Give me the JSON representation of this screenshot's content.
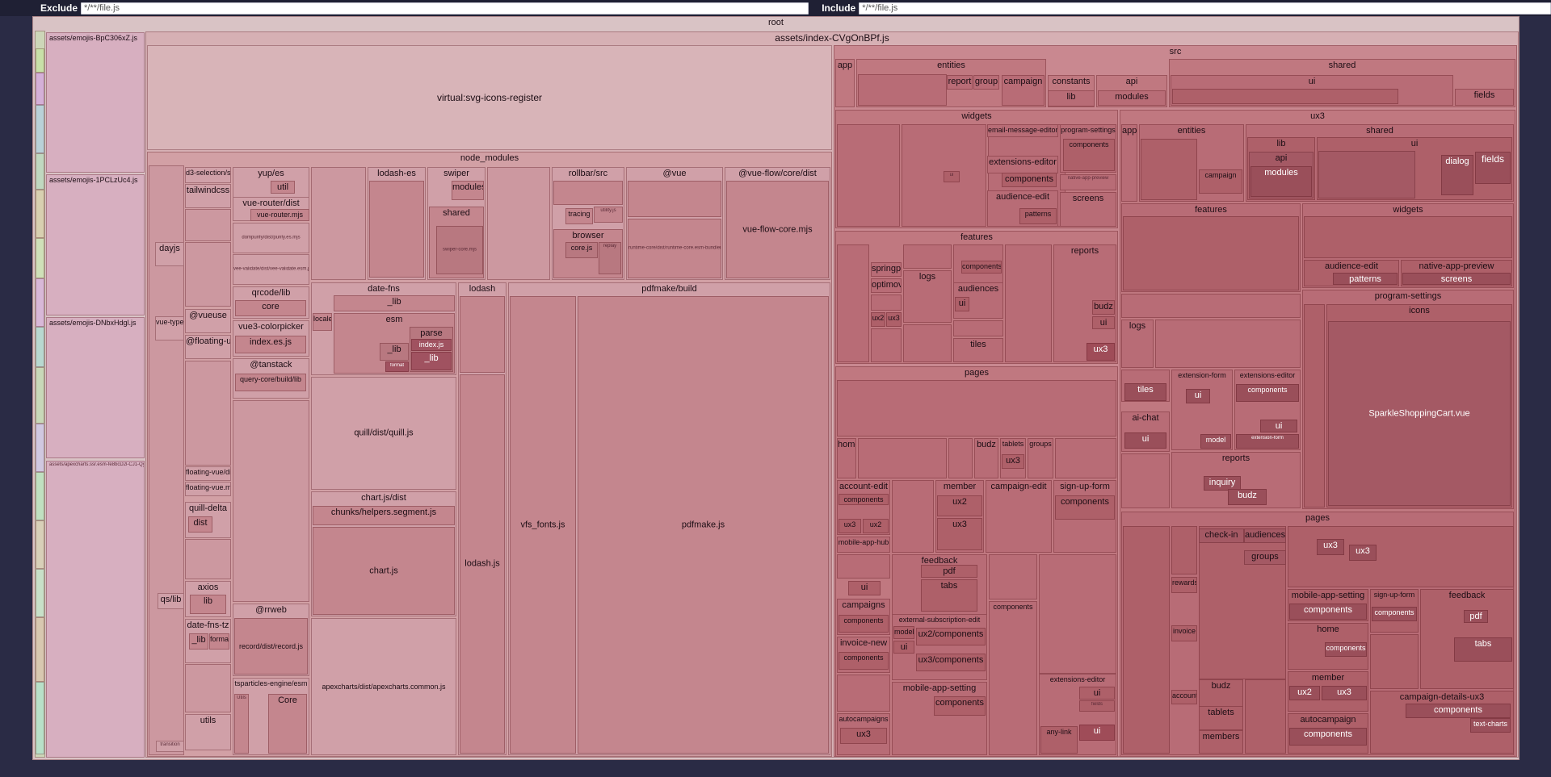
{
  "filters": {
    "exclude_label": "Exclude",
    "exclude_value": "*/**/file.js",
    "include_label": "Include",
    "include_value": "*/**/file.js"
  },
  "colors": {
    "background": "#2a2b45",
    "root": "#d9c3c5",
    "emoji": "#d7afc0",
    "index": "#d6b0b4",
    "node_modules": "#d2a0a5",
    "src": "#c98890",
    "dense": "#b7626d"
  },
  "treemap": {
    "root": "root",
    "emoji_chunks": [
      "assets/emojis-BpC306xZ.js",
      "assets/emojis-1PCLzUc4.js",
      "assets/emojis-DNbxHdgl.js",
      "assets/apexcharts.ssr.esm-fe8bcD2l-CJ1-Qyal.js"
    ],
    "index": {
      "title": "assets/index-CVgOnBPf.js",
      "svg_icons": "virtual:svg-icons-register",
      "node_modules": {
        "title": "node_modules",
        "packages": {
          "d3": "d3-selection/src",
          "tailwind": "tailwindcss",
          "dayjs": "dayjs",
          "vueuse": "@vueuse",
          "floating_ui": "@floating-ui",
          "vue_types": "vue-types",
          "floating_vue": "floating-vue/dist",
          "floating_vue_mjs": "floating-vue.mjs",
          "quill_delta": "quill-delta",
          "quill_delta_dist": "dist",
          "axios": "axios",
          "axios_lib": "lib",
          "qs": "qs/lib",
          "date_fns_tz": "date-fns-tz",
          "date_fns_tz_lib": "_lib",
          "date_fns_tz_format": "format",
          "utils": "utils",
          "transition": "transition",
          "yup": "yup/es",
          "yup_util": "util",
          "vue_router": "vue-router/dist",
          "vue_router_mjs": "vue-router.mjs",
          "dompurify": "dompurify/dist/purify.es.mjs",
          "vee_validate": "vee-validate/dist/vee-validate.esm.js",
          "qrcode": "qrcode/lib",
          "qrcode_core": "core",
          "colorpicker": "vue3-colorpicker",
          "colorpicker_index": "index.es.js",
          "tanstack": "@tanstack",
          "query_core": "query-core/build/lib",
          "rrweb": "@rrweb",
          "rrweb_record": "record/dist/record.js",
          "tsparticles": "tsparticles-engine/esm",
          "tsparticles_core": "Core",
          "tsparticles_utils": "Utils",
          "lodash_es": "lodash-es",
          "swiper": "swiper",
          "swiper_modules": "modules",
          "swiper_shared": "shared",
          "swiper_core": "swiper-core.mjs",
          "date_fns": "date-fns",
          "date_fns_lib": "_lib",
          "esm": "esm",
          "locale": "locale",
          "parse": "parse",
          "parse_index": "index.js",
          "parse_lib": "_lib",
          "esm_lib": "_lib",
          "esm_format": "format",
          "quill": "quill/dist/quill.js",
          "chartjs": "chart.js/dist",
          "chart_helpers": "chunks/helpers.segment.js",
          "chart_js": "chart.js",
          "apexcharts": "apexcharts/dist/apexcharts.common.js",
          "lodash": "lodash",
          "lodash_js": "lodash.js",
          "rollbar": "rollbar/src",
          "rollbar_utility": "utility.js",
          "rollbar_tracing": "tracing",
          "rollbar_browser": "browser",
          "rollbar_core": "core.js",
          "rollbar_replay": "replay",
          "vue": "@vue",
          "runtime_core": "runtime-core/dist/runtime-core.esm-bundler.js",
          "vue_flow": "@vue-flow/core/dist",
          "vue_flow_mjs": "vue-flow-core.mjs",
          "pdfmake": "pdfmake/build",
          "vfs_fonts": "vfs_fonts.js",
          "pdfmake_js": "pdfmake.js"
        }
      },
      "src": {
        "title": "src",
        "app": "app",
        "entities": "entities",
        "entities_items": [
          "report",
          "group",
          "campaign"
        ],
        "constants": "constants",
        "lib": "lib",
        "api": "api",
        "modules": "modules",
        "shared": "shared",
        "shared_ui": "ui",
        "shared_fields": "fields",
        "widgets": "widgets",
        "widgets_items": {
          "email_message_editor": "email-message-editor",
          "program_settings": "program-settings",
          "components": "components",
          "extensions_editor": "extensions-editor",
          "components2": "components",
          "native_app_preview": "native-app-preview",
          "audience_edit": "audience-edit",
          "patterns": "patterns",
          "screens": "screens",
          "ui": "ui",
          "ui2": "ui"
        },
        "features": "features",
        "features_items": {
          "springpay": "springpay",
          "optimove": "optimove",
          "logs": "logs",
          "ux2": "ux2",
          "ux3": "ux3",
          "audiences": "audiences",
          "ui": "ui",
          "components": "components",
          "tiles": "tiles",
          "reports": "reports",
          "budz": "budz",
          "ui2": "ui",
          "ux3b": "ux3"
        },
        "pages": "pages",
        "pages_items": {
          "home": "home",
          "budz": "budz",
          "tablets": "tablets",
          "groups": "groups",
          "ux3": "ux3",
          "account_edit": "account-edit",
          "components": "components",
          "ux3b": "ux3",
          "ux2": "ux2",
          "member": "member",
          "member_ux2": "ux2",
          "member_ux3": "ux3",
          "campaign_edit": "campaign-edit",
          "sign_up_form": "sign-up-form",
          "sign_up_components": "components",
          "mobile_app_hub": "mobile-app-hub",
          "ui": "ui",
          "campaigns": "campaigns",
          "campaigns_components": "components",
          "invoice_new": "invoice-new",
          "invoice_components": "components",
          "autocampaigns": "autocampaigns",
          "autocampaigns_ux3": "ux3",
          "feedback": "feedback",
          "pdf": "pdf",
          "tabs": "tabs",
          "ext_sub_edit": "external-subscription-edit",
          "model": "model",
          "ui2": "ui",
          "ux2_components": "ux2/components",
          "ux3_components": "ux3/components",
          "mobile_app_setting": "mobile-app-setting",
          "mas_components": "components",
          "components_col": "components",
          "extensions_editor": "extensions-editor",
          "ee_ui": "ui",
          "ee_fields": "fields",
          "any_link": "any-link",
          "ee_ui2": "ui"
        },
        "ux3": {
          "title": "ux3",
          "app": "app",
          "entities": "entities",
          "campaign": "campaign",
          "shared": "shared",
          "lib": "lib",
          "api": "api",
          "modules": "modules",
          "ui": "ui",
          "fields": "fields",
          "dialog": "dialog",
          "features": "features",
          "widgets": "widgets",
          "audience_edit": "audience-edit",
          "patterns": "patterns",
          "native_app_preview": "native-app-preview",
          "screens": "screens",
          "program_settings": "program-settings",
          "icons": "icons",
          "sparkle": "SparkleShoppingCart.vue",
          "logs": "logs",
          "tiles": "tiles",
          "ai_chat": "ai-chat",
          "ai_ui": "ui",
          "extension_form": "extension-form",
          "ext_ui": "ui",
          "model": "model",
          "extensions_editor": "extensions-editor",
          "ee_components": "components",
          "ee_ui": "ui",
          "ee_extension_form": "extension-form",
          "reports": "reports",
          "inquiry": "inquiry",
          "budz": "budz",
          "pages": "pages",
          "check_in": "check-in",
          "audiences": "audiences",
          "groups": "groups",
          "p_ux3": "ux3",
          "p_ux3b": "ux3",
          "mobile_app_setting": "mobile-app-setting",
          "mas_components": "components",
          "home": "home",
          "home_components": "components",
          "member": "member",
          "member_ux2": "ux2",
          "member_ux3": "ux3",
          "autocampaign": "autocampaign",
          "ac_components": "components",
          "feedback": "feedback",
          "fb_pdf": "pdf",
          "fb_tabs": "tabs",
          "cdux3": "campaign-details-ux3",
          "cd_components": "components",
          "cd_text_charts": "text-charts",
          "budz2": "budz",
          "tablets": "tablets",
          "account": "account",
          "members": "members",
          "sign_up_form": "sign-up-form",
          "suf_components": "components",
          "invoice": "invoice",
          "rewards": "rewards"
        }
      }
    }
  }
}
